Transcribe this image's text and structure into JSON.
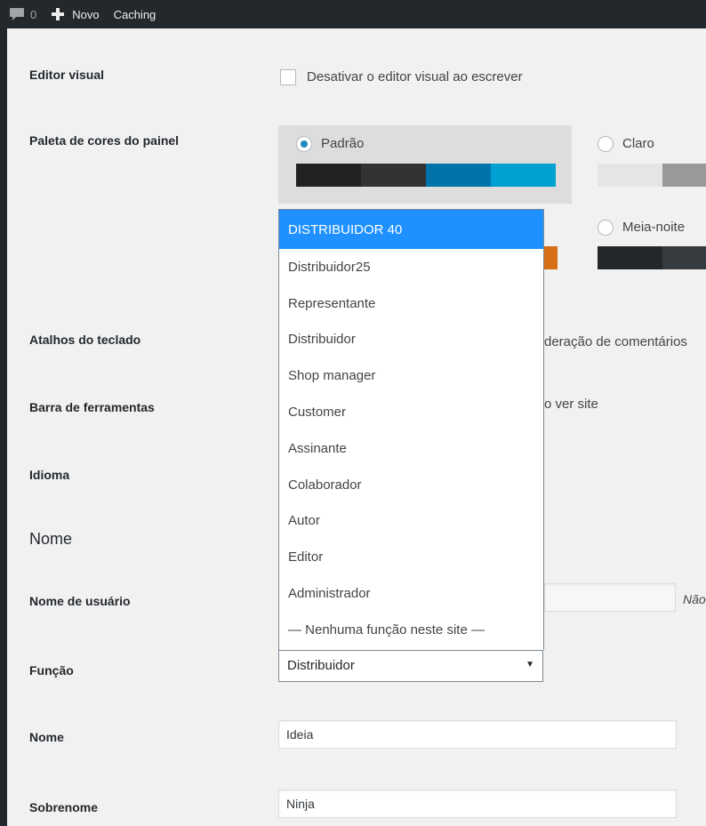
{
  "adminbar": {
    "comments_count": "0",
    "new_label": "Novo",
    "caching_label": "Caching"
  },
  "editor_visual": {
    "label": "Editor visual",
    "checkbox_text": "Desativar o editor visual ao escrever"
  },
  "color_scheme": {
    "label": "Paleta de cores do painel",
    "schemes": [
      {
        "name": "Padrão",
        "checked": true,
        "colors": [
          "#222222",
          "#333333",
          "#0073aa",
          "#00a0d2"
        ]
      },
      {
        "name": "Claro",
        "checked": false,
        "colors": [
          "#e5e5e5",
          "#999999",
          "#d64e07",
          "#04a4cc"
        ]
      },
      {
        "name": "Meia-noite",
        "checked": false,
        "colors": [
          "#25282b",
          "#363b3f",
          "#69a8bb",
          "#e14d43"
        ]
      }
    ],
    "partial_swatch_color": "#d46f15"
  },
  "keyboard": {
    "label": "Atalhos do teclado",
    "partial_text": "deração de comentários"
  },
  "toolbar": {
    "label": "Barra de ferramentas",
    "partial_text": "o ver site"
  },
  "language": {
    "label": "Idioma"
  },
  "name_section": {
    "title": "Nome"
  },
  "username": {
    "label": "Nome de usuário",
    "note_partial": "Não"
  },
  "role": {
    "label": "Função",
    "selected": "Distribuidor",
    "options": [
      "DISTRIBUIDOR 40",
      "Distribuidor25",
      "Representante",
      "Distribuidor",
      "Shop manager",
      "Customer",
      "Assinante",
      "Colaborador",
      "Autor",
      "Editor",
      "Administrador",
      "— Nenhuma função neste site —"
    ],
    "highlight_color": "#1e90ff"
  },
  "first_name": {
    "label": "Nome",
    "value": "Ideia"
  },
  "last_name": {
    "label": "Sobrenome",
    "value": "Ninja"
  }
}
